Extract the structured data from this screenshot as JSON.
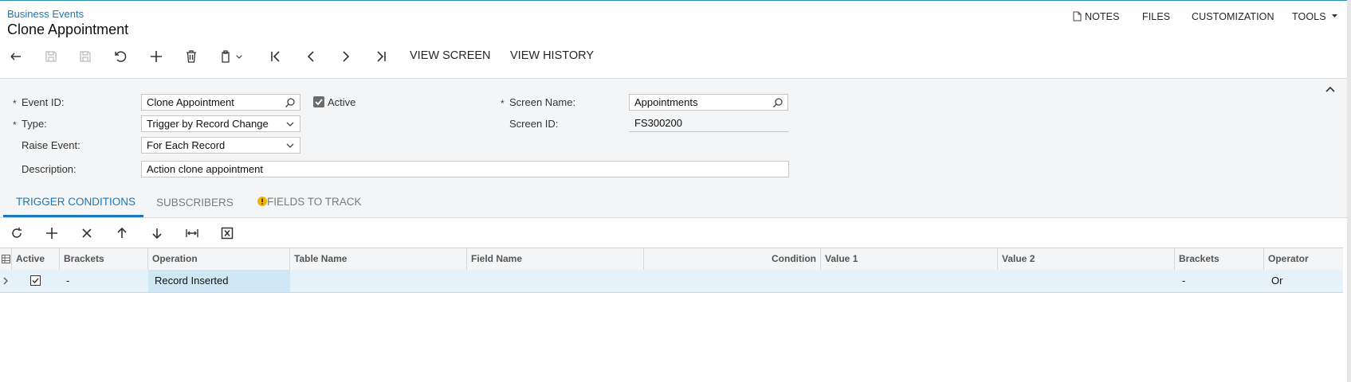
{
  "header": {
    "breadcrumb": "Business Events",
    "title": "Clone Appointment",
    "links": {
      "notes": "NOTES",
      "files": "FILES",
      "customization": "CUSTOMIZATION",
      "tools": "TOOLS"
    }
  },
  "toolbar": {
    "view_screen": "VIEW SCREEN",
    "view_history": "VIEW HISTORY"
  },
  "form": {
    "event_id": {
      "label": "Event ID:",
      "value": "Clone Appointment"
    },
    "active": {
      "label": "Active",
      "checked": true
    },
    "type": {
      "label": "Type:",
      "value": "Trigger by Record Change"
    },
    "raise_event": {
      "label": "Raise Event:",
      "value": "For Each Record"
    },
    "description": {
      "label": "Description:",
      "value": "Action clone appointment"
    },
    "screen_name": {
      "label": "Screen Name:",
      "value": "Appointments"
    },
    "screen_id": {
      "label": "Screen ID:",
      "value": "FS300200"
    },
    "required_mark": "*"
  },
  "tabs": [
    {
      "label": "TRIGGER CONDITIONS",
      "active": true
    },
    {
      "label": "SUBSCRIBERS",
      "active": false
    },
    {
      "label": "FIELDS TO TRACK",
      "active": false,
      "warning": true
    }
  ],
  "grid": {
    "columns": [
      "Active",
      "Brackets",
      "Operation",
      "Table Name",
      "Field Name",
      "Condition",
      "Value 1",
      "Value 2",
      "Brackets",
      "Operator"
    ],
    "rows": [
      {
        "active": true,
        "brackets_open": "-",
        "operation": "Record Inserted",
        "table_name": "",
        "field_name": "",
        "condition": "",
        "value1": "",
        "value2": "",
        "brackets_close": "-",
        "operator": "Or"
      }
    ]
  },
  "colors": {
    "accent": "#1a78b8",
    "form_bg": "#f4f5f6",
    "selected_row": "#e5f2f9",
    "selected_cell": "#cfe6f5",
    "warning": "#f0b400"
  }
}
